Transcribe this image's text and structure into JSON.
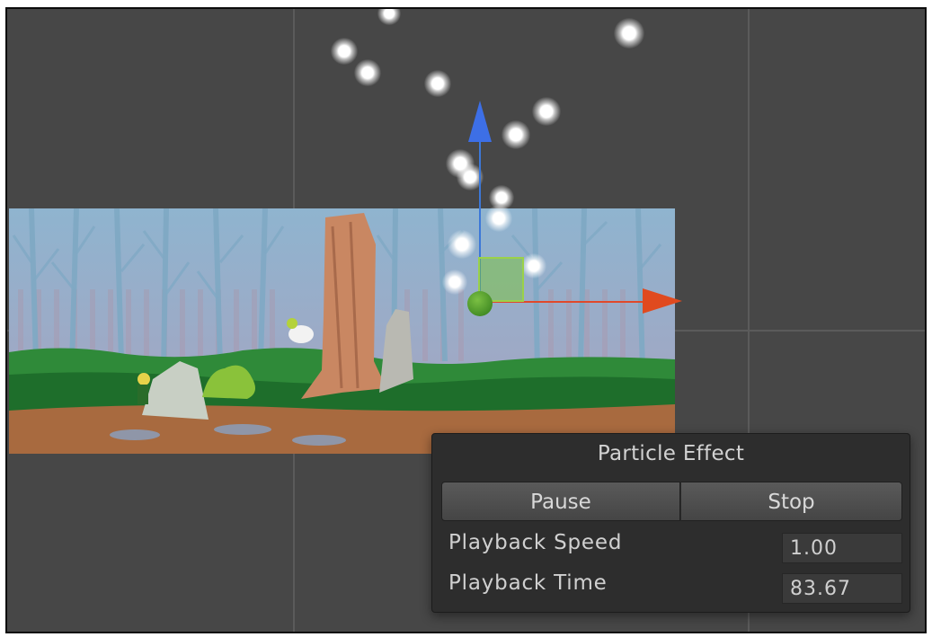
{
  "window": {
    "background_color": "#474747",
    "grid_color": "#5b5b5b"
  },
  "scene": {
    "description_icon": "forest-scene-sprite",
    "gizmo": {
      "y_axis_color": "#3d6fe6",
      "x_axis_color": "#e04a1f",
      "plane_color": "#9bd14a"
    }
  },
  "particle_panel": {
    "title": "Particle Effect",
    "pause_label": "Pause",
    "stop_label": "Stop",
    "playback_speed_label": "Playback Speed",
    "playback_speed_value": "1.00",
    "playback_time_label": "Playback Time",
    "playback_time_value": "83.67"
  }
}
